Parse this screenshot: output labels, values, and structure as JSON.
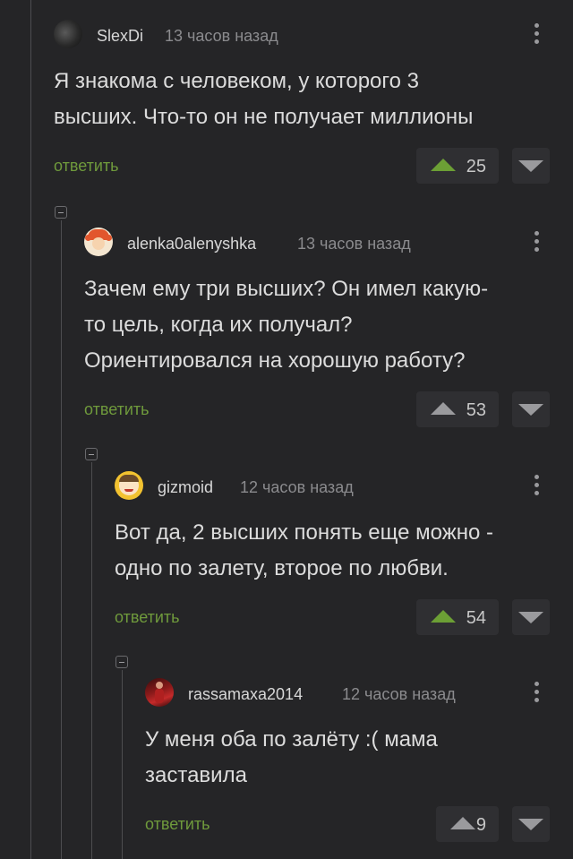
{
  "comments": [
    {
      "author": "SlexDi",
      "time": "13 часов назад",
      "text_lines": [
        "Я знакома с человеком, у которого 3",
        "высших. Что-то он не получает миллионы"
      ],
      "reply_label": "ответить",
      "votes": "25",
      "vote_color": "#6c9f35",
      "avatar": "dark-photo-avatar"
    },
    {
      "author": "alenka0alenyshka",
      "time": "13 часов назад",
      "text_lines": [
        "Зачем ему три высших? Он имел какую-",
        "то цель, когда их получал?",
        "Ориентировался на хорошую работу?"
      ],
      "reply_label": "ответить",
      "votes": "53",
      "vote_color": "#9a9a9d",
      "avatar": "redhead-girl-avatar"
    },
    {
      "author": "gizmoid",
      "time": "12 часов назад",
      "text_lines": [
        "Вот да, 2 высших понять еще можно -",
        "одно по залету, второе по любви."
      ],
      "reply_label": "ответить",
      "votes": "54",
      "vote_color": "#6c9f35",
      "avatar": "cartoon-face-avatar"
    },
    {
      "author": "rassamaxa2014",
      "time": "12 часов назад",
      "text_lines": [
        "У меня оба по залёту :( мама",
        "заставила"
      ],
      "reply_label": "ответить",
      "votes": "9",
      "vote_color": "#9a9a9d",
      "avatar": "red-photo-avatar"
    }
  ]
}
